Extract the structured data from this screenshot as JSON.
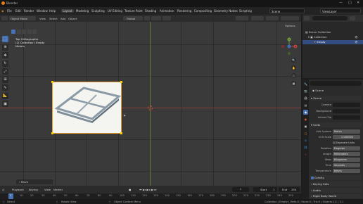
{
  "window": {
    "title": "Blender",
    "controls": [
      "—",
      "□",
      "✕"
    ]
  },
  "menu": {
    "items": [
      "File",
      "Edit",
      "Render",
      "Window",
      "Help"
    ],
    "workspaces": [
      "Layout",
      "Modeling",
      "Sculpting",
      "UV Editing",
      "Texture Paint",
      "Shading",
      "Animation",
      "Rendering",
      "Compositing",
      "Geometry Nodes",
      "Scripting"
    ],
    "active_workspace": "Layout",
    "scene": "Scene",
    "view_layer": "ViewLayer"
  },
  "viewport_header": {
    "mode": "Object Mode",
    "menus": [
      "View",
      "Select",
      "Add",
      "Object"
    ],
    "orientation": "Global",
    "options": "Options"
  },
  "viewport_overlay": {
    "line1": "Top Orthographic",
    "line2": "(1) Collection | Empty",
    "line3": "Meters"
  },
  "gizmo": {
    "x": "X",
    "y": "Y",
    "z": "Z"
  },
  "operator_panel": {
    "label": "Move"
  },
  "timeline": {
    "menus": [
      "Playback",
      "Keying",
      "View",
      "Marker"
    ],
    "current_frame": "1",
    "start_label": "Start",
    "start": "1",
    "end_label": "End",
    "end": "250",
    "ticks": [
      "0",
      "10",
      "20",
      "30",
      "40",
      "50",
      "60",
      "70",
      "80",
      "90",
      "100",
      "110",
      "120",
      "130",
      "140",
      "150",
      "160",
      "170",
      "180",
      "190",
      "200",
      "210",
      "220",
      "230",
      "240",
      "250"
    ]
  },
  "statusbar": {
    "select": "Select",
    "rotate": "Rotate View",
    "context": "Object Context Menu",
    "stats": "Collection | Empty | Verts:0 | Faces:0 | Tris:0 | Objects:1/1 | 3.1"
  },
  "outliner": {
    "root": "Scene Collection",
    "collection": "Collection",
    "object": "Empty"
  },
  "properties": {
    "title": "Scene",
    "scene_section": "Scene",
    "camera_label": "Camera",
    "background_label": "Background",
    "active_clip_label": "Active Clip",
    "units_section": "Units",
    "unit_system_label": "Unit System",
    "unit_system": "Metric",
    "unit_scale_label": "Unit Scale",
    "unit_scale": "1.000000",
    "separate_units": "Separate Units",
    "rotation_label": "Rotation",
    "rotation": "Degrees",
    "length_label": "Length",
    "length": "Millimeters",
    "mass_label": "Mass",
    "mass": "Kilograms",
    "time_label": "Time",
    "time": "Seconds",
    "temperature_label": "Temperature",
    "temperature": "Kelvin",
    "gravity": "Gravity",
    "keying_sets": "Keying Sets",
    "audio": "Audio",
    "rigid_body_world": "Rigid Body World"
  },
  "colors": {
    "accent": "#4772b3",
    "selection": "#e69b2d",
    "x_axis": "#c8423f",
    "y_axis": "#7aa63a"
  }
}
